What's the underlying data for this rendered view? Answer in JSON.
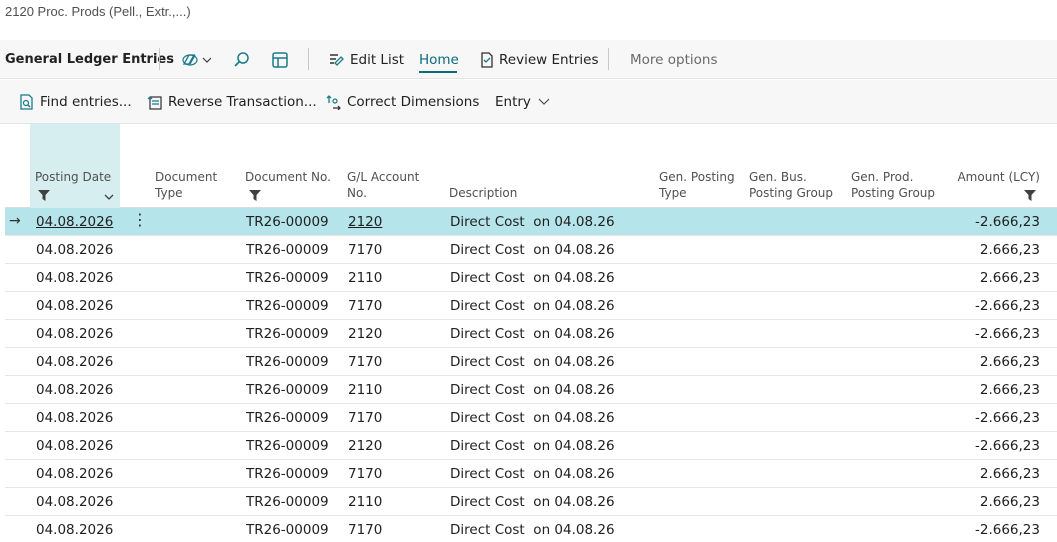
{
  "caption": "2120 Proc. Prods (Pell., Extr.,...)",
  "command_bar": {
    "page_title": "General Ledger Entries",
    "edit_list": "Edit List",
    "home": "Home",
    "review_entries": "Review Entries",
    "more_options": "More options"
  },
  "action_bar": {
    "find_entries": "Find entries...",
    "reverse_transaction": "Reverse Transaction...",
    "correct_dimensions": "Correct Dimensions",
    "entry": "Entry"
  },
  "columns": {
    "posting_date": "Posting Date",
    "document_type_1": "Document",
    "document_type_2": "Type",
    "document_no": "Document No.",
    "gl_account_1": "G/L Account",
    "gl_account_2": "No.",
    "description": "Description",
    "gen_posting_type_1": "Gen. Posting",
    "gen_posting_type_2": "Type",
    "gen_bus_1": "Gen. Bus.",
    "gen_bus_2": "Posting Group",
    "gen_prod_1": "Gen. Prod.",
    "gen_prod_2": "Posting Group",
    "amount": "Amount (LCY)"
  },
  "rows": [
    {
      "date": "04.08.2026",
      "doc_no": "TR26-00009",
      "account": "2120",
      "description": "Direct Cost  on 04.08.26",
      "amount": "-2.666,23"
    },
    {
      "date": "04.08.2026",
      "doc_no": "TR26-00009",
      "account": "7170",
      "description": "Direct Cost  on 04.08.26",
      "amount": "2.666,23"
    },
    {
      "date": "04.08.2026",
      "doc_no": "TR26-00009",
      "account": "2110",
      "description": "Direct Cost  on 04.08.26",
      "amount": "2.666,23"
    },
    {
      "date": "04.08.2026",
      "doc_no": "TR26-00009",
      "account": "7170",
      "description": "Direct Cost  on 04.08.26",
      "amount": "-2.666,23"
    },
    {
      "date": "04.08.2026",
      "doc_no": "TR26-00009",
      "account": "2120",
      "description": "Direct Cost  on 04.08.26",
      "amount": "-2.666,23"
    },
    {
      "date": "04.08.2026",
      "doc_no": "TR26-00009",
      "account": "7170",
      "description": "Direct Cost  on 04.08.26",
      "amount": "2.666,23"
    },
    {
      "date": "04.08.2026",
      "doc_no": "TR26-00009",
      "account": "2110",
      "description": "Direct Cost  on 04.08.26",
      "amount": "2.666,23"
    },
    {
      "date": "04.08.2026",
      "doc_no": "TR26-00009",
      "account": "7170",
      "description": "Direct Cost  on 04.08.26",
      "amount": "-2.666,23"
    },
    {
      "date": "04.08.2026",
      "doc_no": "TR26-00009",
      "account": "2120",
      "description": "Direct Cost  on 04.08.26",
      "amount": "-2.666,23"
    },
    {
      "date": "04.08.2026",
      "doc_no": "TR26-00009",
      "account": "7170",
      "description": "Direct Cost  on 04.08.26",
      "amount": "2.666,23"
    },
    {
      "date": "04.08.2026",
      "doc_no": "TR26-00009",
      "account": "2110",
      "description": "Direct Cost  on 04.08.26",
      "amount": "2.666,23"
    },
    {
      "date": "04.08.2026",
      "doc_no": "TR26-00009",
      "account": "7170",
      "description": "Direct Cost  on 04.08.26",
      "amount": "-2.666,23"
    }
  ],
  "colors": {
    "accent": "#0c6b7a",
    "selected_row": "#b5e5ea",
    "sorted_column": "#d7eef1"
  }
}
